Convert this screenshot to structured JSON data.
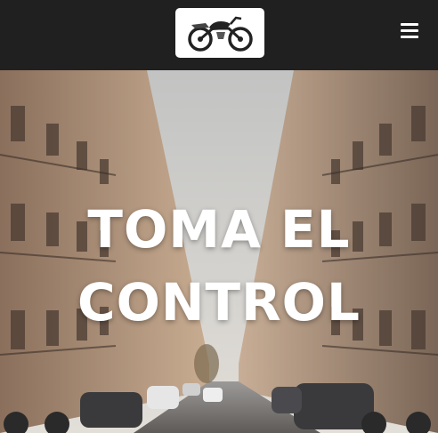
{
  "header": {
    "logo_icon": "motorcycle-icon",
    "menu_icon": "hamburger-menu-icon"
  },
  "hero": {
    "title_line1": "TOMA EL",
    "title_line2": "CONTROL"
  },
  "colors": {
    "header_bg": "#202020",
    "hero_text": "#ffffff"
  }
}
